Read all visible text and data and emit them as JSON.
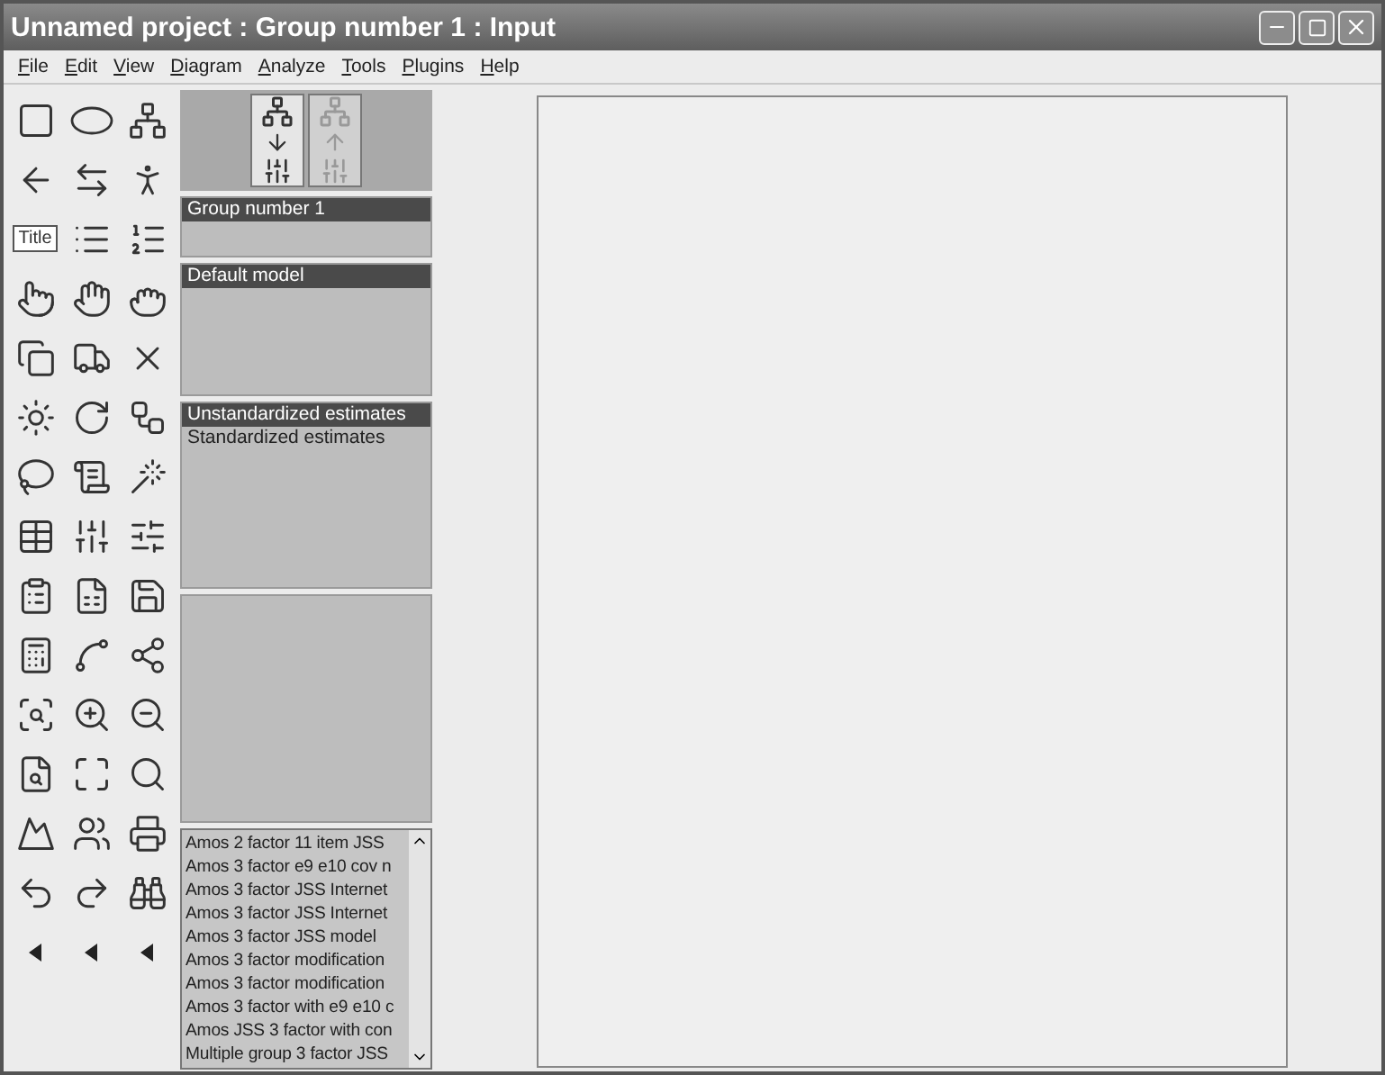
{
  "window": {
    "title": "Unnamed project : Group number 1 : Input"
  },
  "menu": [
    "File",
    "Edit",
    "View",
    "Diagram",
    "Analyze",
    "Tools",
    "Plugins",
    "Help"
  ],
  "toolbar": {
    "title_tool": "Title"
  },
  "groups": [
    {
      "label": "Group number 1",
      "selected": true
    }
  ],
  "models": [
    {
      "label": "Default model",
      "selected": true
    }
  ],
  "estimates": [
    {
      "label": "Unstandardized estimates",
      "selected": true
    },
    {
      "label": "Standardized estimates",
      "selected": false
    }
  ],
  "files": [
    "Amos 2 factor 11 item JSS",
    "Amos 3 factor e9 e10 cov n",
    "Amos 3 factor JSS Internet",
    "Amos 3 factor JSS Internet",
    "Amos 3 factor JSS model",
    "Amos 3 factor modification",
    "Amos 3 factor modification",
    "Amos 3 factor with e9 e10 c",
    "Amos JSS 3 factor with con",
    "Multiple group 3 factor JSS"
  ]
}
